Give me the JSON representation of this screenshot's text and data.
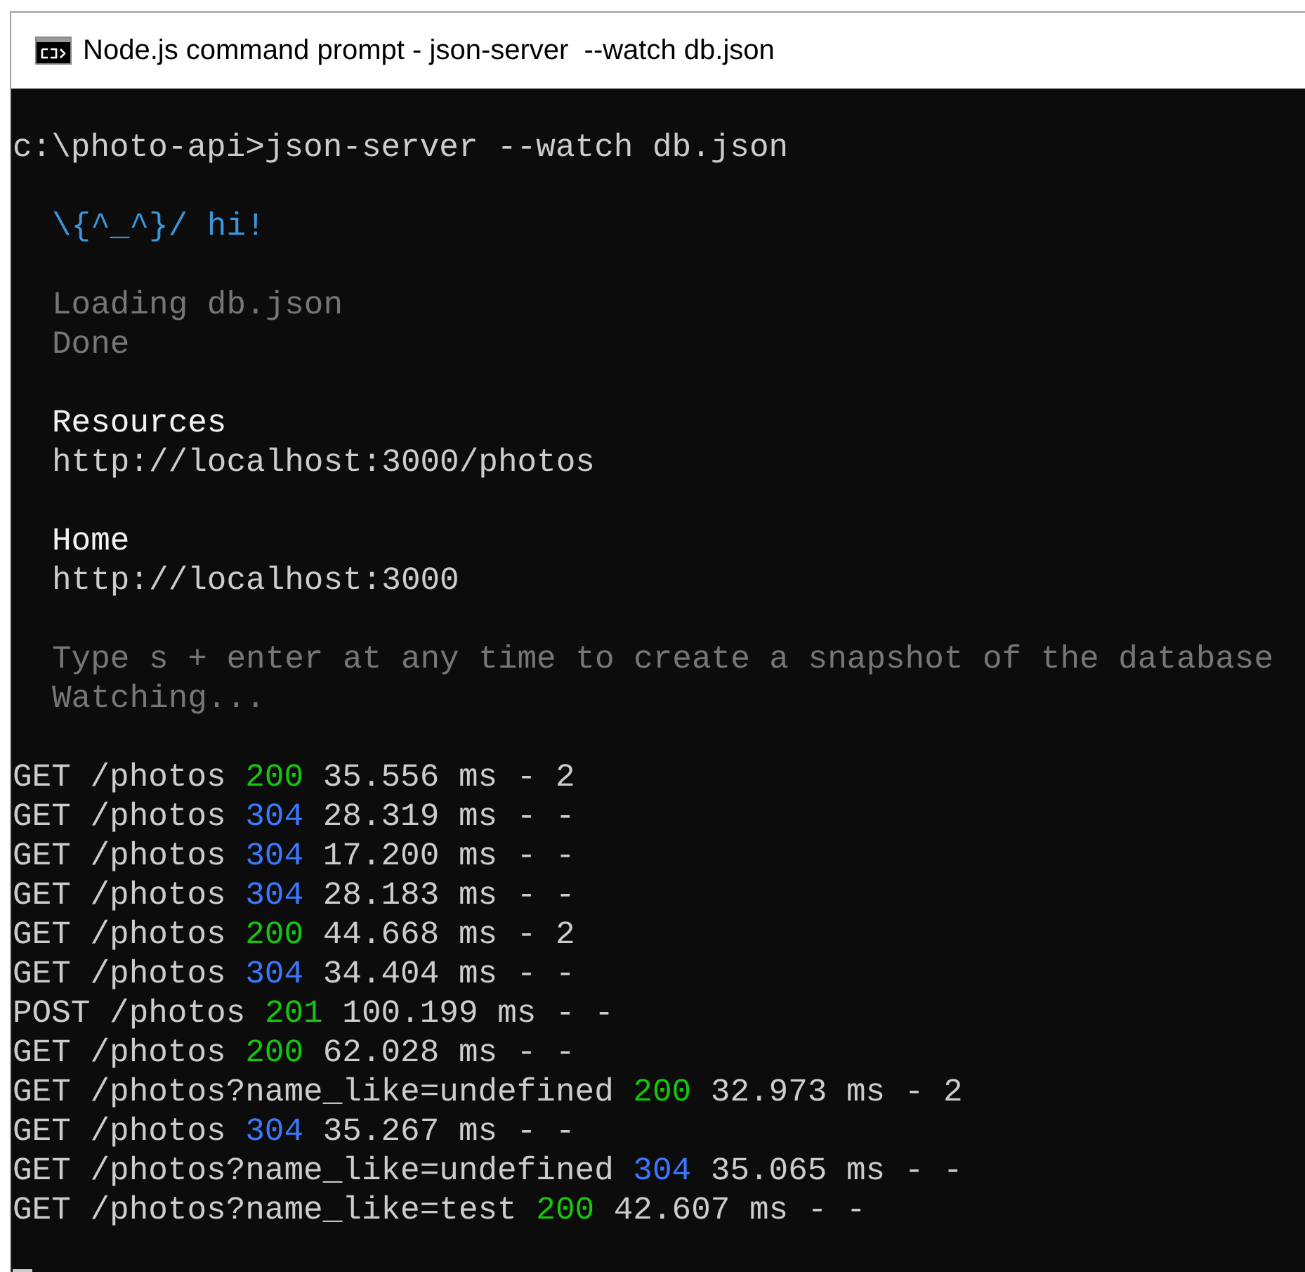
{
  "window": {
    "title": "Node.js command prompt - json-server  --watch db.json"
  },
  "prompt_line": "c:\\photo-api>json-server --watch db.json",
  "banner_blocks": [
    [
      {
        "text": "\\{^_^}/ hi!",
        "kind": "accent"
      }
    ],
    [
      {
        "text": "Loading db.json",
        "kind": "dim"
      },
      {
        "text": "Done",
        "kind": "dim"
      }
    ],
    [
      {
        "text": "Resources",
        "kind": "bright"
      },
      {
        "text": "http://localhost:3000/photos",
        "kind": "normal"
      }
    ],
    [
      {
        "text": "Home",
        "kind": "bright"
      },
      {
        "text": "http://localhost:3000",
        "kind": "normal"
      }
    ],
    [
      {
        "text": "Type s + enter at any time to create a snapshot of the database",
        "kind": "dim"
      },
      {
        "text": "Watching...",
        "kind": "dim"
      }
    ]
  ],
  "requests": [
    {
      "request": "GET /photos",
      "status": "200",
      "color": "#16c60c",
      "detail": "35.556 ms - 2"
    },
    {
      "request": "GET /photos",
      "status": "304",
      "color": "#3b78ff",
      "detail": "28.319 ms - -"
    },
    {
      "request": "GET /photos",
      "status": "304",
      "color": "#3b78ff",
      "detail": "17.200 ms - -"
    },
    {
      "request": "GET /photos",
      "status": "304",
      "color": "#3b78ff",
      "detail": "28.183 ms - -"
    },
    {
      "request": "GET /photos",
      "status": "200",
      "color": "#16c60c",
      "detail": "44.668 ms - 2"
    },
    {
      "request": "GET /photos",
      "status": "304",
      "color": "#3b78ff",
      "detail": "34.404 ms - -"
    },
    {
      "request": "POST /photos",
      "status": "201",
      "color": "#16c60c",
      "detail": "100.199 ms - -"
    },
    {
      "request": "GET /photos",
      "status": "200",
      "color": "#16c60c",
      "detail": "62.028 ms - -"
    },
    {
      "request": "GET /photos?name_like=undefined",
      "status": "200",
      "color": "#16c60c",
      "detail": "32.973 ms - 2"
    },
    {
      "request": "GET /photos",
      "status": "304",
      "color": "#3b78ff",
      "detail": "35.267 ms - -"
    },
    {
      "request": "GET /photos?name_like=undefined",
      "status": "304",
      "color": "#3b78ff",
      "detail": "35.065 ms - -"
    },
    {
      "request": "GET /photos?name_like=test",
      "status": "200",
      "color": "#16c60c",
      "detail": "42.607 ms - -"
    }
  ]
}
